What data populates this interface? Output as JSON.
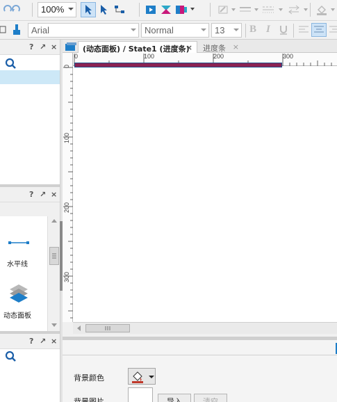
{
  "toolbar": {
    "zoom": "100%",
    "font_family": "Arial",
    "font_style": "Normal",
    "font_size": "13",
    "bold_label": "B",
    "italic_label": "I"
  },
  "left_panels": {
    "widgets": [
      {
        "label": "水平线",
        "icon": "horizontal-line-icon"
      },
      {
        "label": "动态面板",
        "icon": "dynamic-panel-icon"
      }
    ],
    "panel_header_help": "?",
    "panel_header_pin": "↗",
    "panel_header_close": "×"
  },
  "tabs": [
    {
      "label": "(动态面板) / State1 (进度条)",
      "close": "×",
      "active": true
    },
    {
      "label": "进度条",
      "close": "×",
      "active": false
    }
  ],
  "ruler": {
    "h_labels": [
      "0",
      "100",
      "200",
      "300"
    ],
    "v_labels": [
      "0",
      "100",
      "200",
      "300"
    ]
  },
  "canvas": {
    "progress_bar_color": "#8b2252",
    "progress_bar_fill": 1.0
  },
  "bottom_panel": {
    "bg_color_label": "背景颜色",
    "bg_image_label": "背景图片",
    "import_label": "导入",
    "clear_label": "清空"
  },
  "colors": {
    "accent": "#1e7ec8",
    "active_tab_bg": "#ffffff"
  }
}
